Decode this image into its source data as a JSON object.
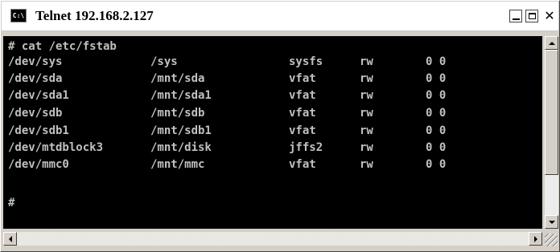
{
  "window": {
    "title": "Telnet 192.168.2.127",
    "icon": "telnet-app-icon",
    "icon_text": "C:\\",
    "controls": {
      "minimize_icon": "minimize-icon",
      "maximize_icon": "maximize-icon",
      "close_glyph": "✕"
    }
  },
  "terminal": {
    "command": "# cat /etc/fstab",
    "fstab": [
      {
        "device": "/dev/sys",
        "mount": "/sys",
        "fs": "sysfs",
        "opts": "rw",
        "dump_pass": "0 0"
      },
      {
        "device": "/dev/sda",
        "mount": "/mnt/sda",
        "fs": "vfat",
        "opts": "rw",
        "dump_pass": "0 0"
      },
      {
        "device": "/dev/sda1",
        "mount": "/mnt/sda1",
        "fs": "vfat",
        "opts": "rw",
        "dump_pass": "0 0"
      },
      {
        "device": "/dev/sdb",
        "mount": "/mnt/sdb",
        "fs": "vfat",
        "opts": "rw",
        "dump_pass": "0 0"
      },
      {
        "device": "/dev/sdb1",
        "mount": "/mnt/sdb1",
        "fs": "vfat",
        "opts": "rw",
        "dump_pass": "0 0"
      },
      {
        "device": "/dev/mtdblock3",
        "mount": "/mnt/disk",
        "fs": "jffs2",
        "opts": "rw",
        "dump_pass": "0 0"
      },
      {
        "device": "/dev/mmc0",
        "mount": "/mnt/mmc",
        "fs": "vfat",
        "opts": "rw",
        "dump_pass": "0 0"
      }
    ],
    "prompt": "#",
    "colors": {
      "background": "#000000",
      "text": "#c0c0c0"
    }
  },
  "scrollbars": {
    "vertical": {
      "up_icon": "arrow-up-icon",
      "down_icon": "arrow-down-icon"
    },
    "horizontal": {
      "left_icon": "arrow-left-icon",
      "right_icon": "arrow-right-icon"
    }
  }
}
